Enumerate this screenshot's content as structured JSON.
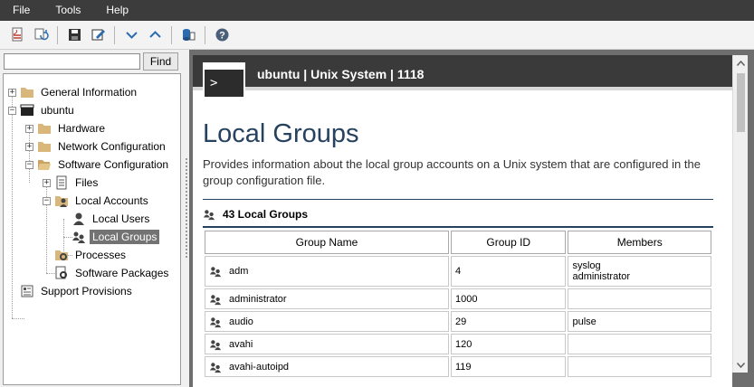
{
  "menubar": {
    "items": [
      "File",
      "Tools",
      "Help"
    ]
  },
  "toolbar": {
    "buttons": [
      "pdf-export-icon",
      "refresh-icon",
      "save-icon",
      "edit-icon",
      "chevron-down-icon",
      "chevron-up-icon",
      "database-icon",
      "help-icon"
    ]
  },
  "search": {
    "value": "",
    "placeholder": "",
    "find_label": "Find"
  },
  "tree": {
    "general_information": "General Information",
    "ubuntu": "ubuntu",
    "hardware": "Hardware",
    "network_configuration": "Network Configuration",
    "software_configuration": "Software Configuration",
    "files": "Files",
    "local_accounts": "Local Accounts",
    "local_users": "Local Users",
    "local_groups": "Local Groups",
    "processes": "Processes",
    "software_packages": "Software Packages",
    "support_provisions": "Support Provisions"
  },
  "banner": {
    "title": "ubuntu | Unix System | 1118",
    "prompt": ">"
  },
  "page": {
    "title": "Local Groups",
    "description": "Provides information about the local group accounts on a Unix system that are configured in the group configuration file."
  },
  "section": {
    "header": "43 Local Groups"
  },
  "table": {
    "headers": {
      "name": "Group Name",
      "id": "Group ID",
      "members": "Members"
    },
    "rows": [
      {
        "name": "adm",
        "id": "4",
        "members": [
          "syslog",
          "administrator"
        ]
      },
      {
        "name": "administrator",
        "id": "1000",
        "members": []
      },
      {
        "name": "audio",
        "id": "29",
        "members": [
          "pulse"
        ]
      },
      {
        "name": "avahi",
        "id": "120",
        "members": []
      },
      {
        "name": "avahi-autoipd",
        "id": "119",
        "members": []
      }
    ]
  },
  "colors": {
    "menubar": "#3c3c3c",
    "banner": "#3a3a3a",
    "title": "#27425f",
    "selection": "#737373"
  }
}
